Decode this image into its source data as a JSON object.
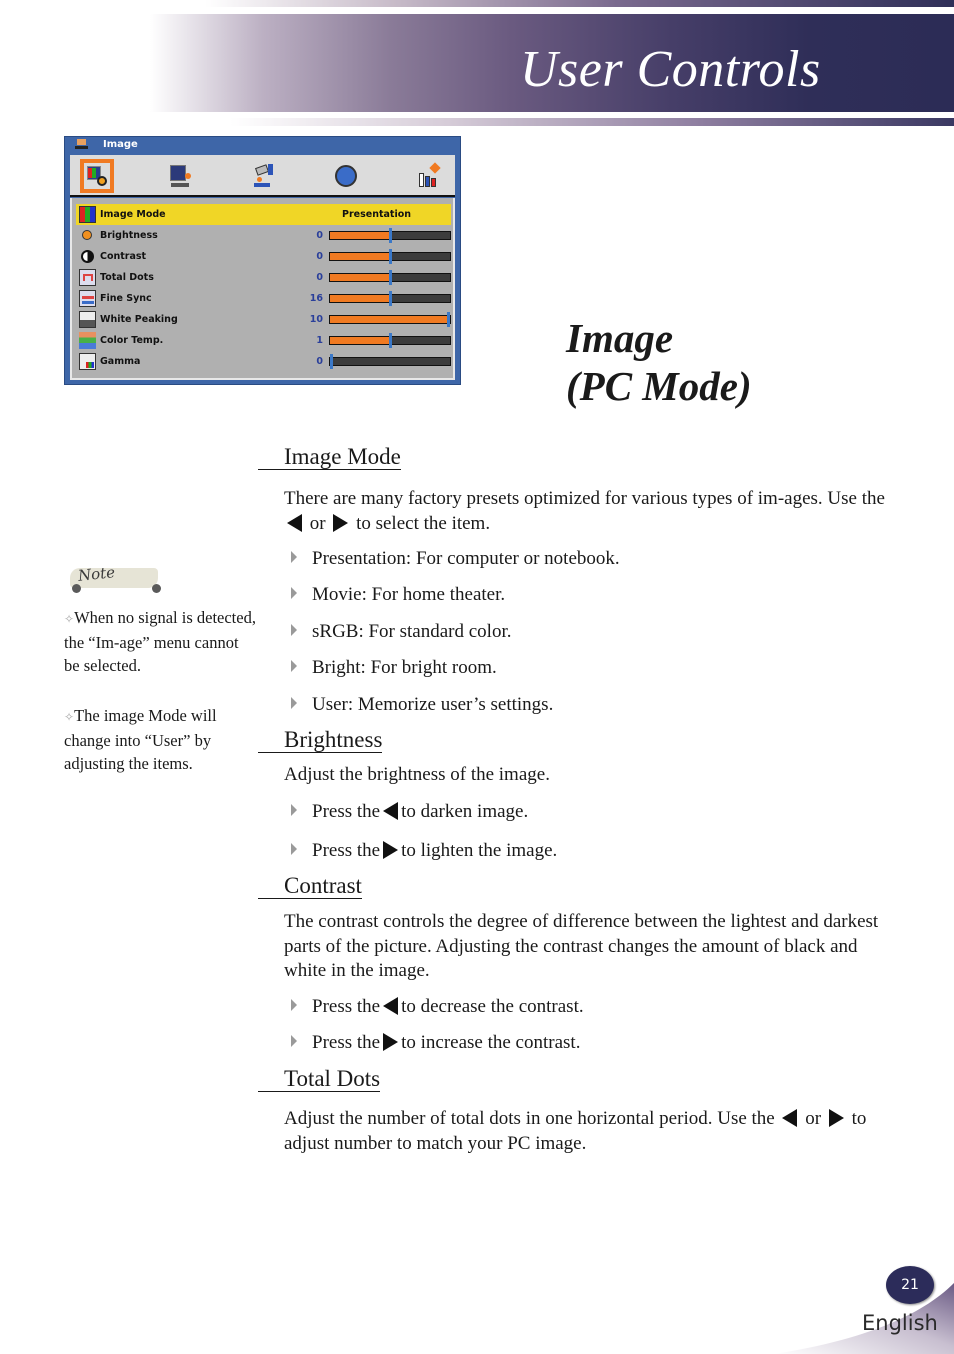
{
  "header": {
    "title": "User Controls"
  },
  "osd_menu": {
    "title": "Image",
    "tabs": [
      {
        "name": "image-tab",
        "icon": "image-settings-icon",
        "active": true
      },
      {
        "name": "screen-tab",
        "icon": "display-settings-icon",
        "active": false
      },
      {
        "name": "setting-tab",
        "icon": "setup-hand-icon",
        "active": false
      },
      {
        "name": "language-tab",
        "icon": "globe-icon",
        "active": false
      },
      {
        "name": "options-tab",
        "icon": "options-chart-icon",
        "active": false
      }
    ],
    "rows": [
      {
        "label": "Image Mode",
        "value_text": "Presentation",
        "icon": "image-mode-icon",
        "selected": true
      },
      {
        "label": "Brightness",
        "value": "0",
        "fraction": 0.5,
        "icon": "brightness-icon"
      },
      {
        "label": "Contrast",
        "value": "0",
        "fraction": 0.5,
        "icon": "contrast-icon"
      },
      {
        "label": "Total Dots",
        "value": "0",
        "fraction": 0.5,
        "icon": "total-dots-icon"
      },
      {
        "label": "Fine Sync",
        "value": "16",
        "fraction": 0.5,
        "icon": "fine-sync-icon"
      },
      {
        "label": "White Peaking",
        "value": "10",
        "fraction": 1.0,
        "icon": "white-peaking-icon"
      },
      {
        "label": "Color Temp.",
        "value": "1",
        "fraction": 0.5,
        "icon": "color-temp-icon"
      },
      {
        "label": "Gamma",
        "value": "0",
        "fraction": 0.0,
        "icon": "gamma-icon"
      }
    ]
  },
  "section_title": {
    "line1": "Image",
    "line2": "(PC Mode)"
  },
  "note": {
    "label": "Note",
    "items": [
      "When no signal is detected, the “Im-age” menu cannot be selected.",
      "The image Mode will change into “User” by adjusting the items."
    ]
  },
  "sections": {
    "image_mode": {
      "heading": "Image Mode",
      "intro_a": "There are many factory presets optimized for various types of im-ages. Use the",
      "intro_or": "or",
      "intro_b": "to select the item.",
      "bullets": [
        "Presentation: For computer or notebook.",
        "Movie: For home theater.",
        "sRGB: For standard color.",
        "Bright: For bright room.",
        "User: Memorize user’s settings."
      ]
    },
    "brightness": {
      "heading": "Brightness",
      "intro": "Adjust the brightness of the image.",
      "b1_pre": "Press the",
      "b1_post": "to darken image.",
      "b2_pre": "Press the",
      "b2_post": "to lighten the image."
    },
    "contrast": {
      "heading": "Contrast",
      "intro": "The contrast controls the degree of difference between the lightest and darkest parts of the picture. Adjusting the contrast changes the amount of black and white in the image.",
      "b1_pre": "Press the",
      "b1_post": "to decrease the contrast.",
      "b2_pre": "Press the",
      "b2_post": "to increase the contrast."
    },
    "total_dots": {
      "heading": "Total Dots",
      "intro_a": "Adjust the number of total dots in one horizontal period. Use the",
      "intro_or": "or",
      "intro_b": "to adjust number to match your PC image."
    }
  },
  "footer": {
    "page_number": "21",
    "language": "English"
  },
  "colors": {
    "header_dark": "#2c2c56",
    "osd_blue": "#3e66a8",
    "osd_highlight": "#f0d626",
    "slider_fill": "#f07a22",
    "slider_knob": "#3a78c8"
  }
}
